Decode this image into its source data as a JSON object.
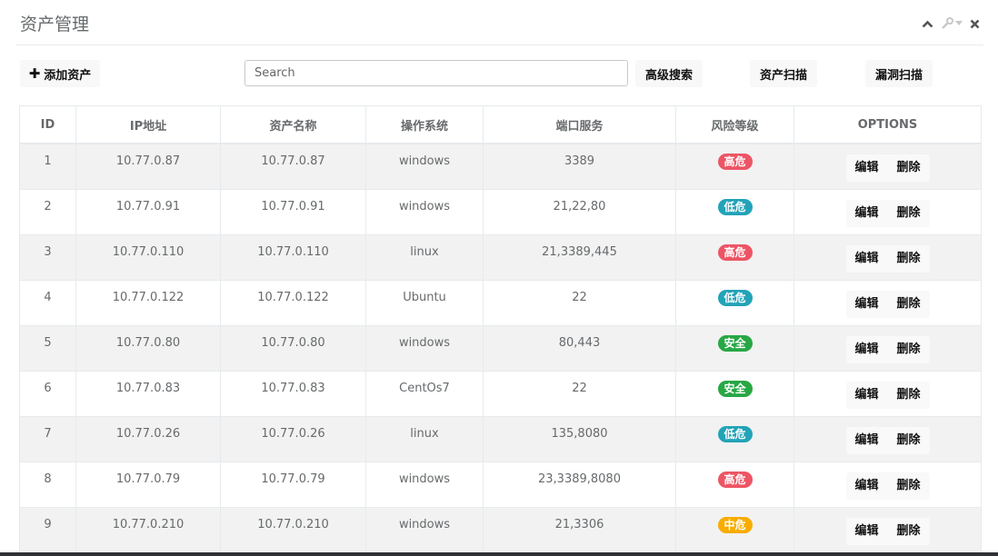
{
  "panel": {
    "title": "资产管理"
  },
  "toolbar": {
    "add_label": "添加资产",
    "search_placeholder": "Search",
    "advanced_search_label": "高级搜索",
    "asset_scan_label": "资产扫描",
    "vuln_scan_label": "漏洞扫描"
  },
  "table": {
    "headers": [
      "ID",
      "IP地址",
      "资产名称",
      "操作系统",
      "端口服务",
      "风险等级",
      "OPTIONS"
    ],
    "edit_label": "编辑",
    "delete_label": "删除",
    "rows": [
      {
        "id": "1",
        "ip": "10.77.0.87",
        "name": "10.77.0.87",
        "os": "windows",
        "ports": "3389",
        "risk": "高危",
        "risk_color": "#ed5565"
      },
      {
        "id": "2",
        "ip": "10.77.0.91",
        "name": "10.77.0.91",
        "os": "windows",
        "ports": "21,22,80",
        "risk": "低危",
        "risk_color": "#23a3b8"
      },
      {
        "id": "3",
        "ip": "10.77.0.110",
        "name": "10.77.0.110",
        "os": "linux",
        "ports": "21,3389,445",
        "risk": "高危",
        "risk_color": "#ed5565"
      },
      {
        "id": "4",
        "ip": "10.77.0.122",
        "name": "10.77.0.122",
        "os": "Ubuntu",
        "ports": "22",
        "risk": "低危",
        "risk_color": "#23a3b8"
      },
      {
        "id": "5",
        "ip": "10.77.0.80",
        "name": "10.77.0.80",
        "os": "windows",
        "ports": "80,443",
        "risk": "安全",
        "risk_color": "#28a745"
      },
      {
        "id": "6",
        "ip": "10.77.0.83",
        "name": "10.77.0.83",
        "os": "CentOs7",
        "ports": "22",
        "risk": "安全",
        "risk_color": "#28a745"
      },
      {
        "id": "7",
        "ip": "10.77.0.26",
        "name": "10.77.0.26",
        "os": "linux",
        "ports": "135,8080",
        "risk": "低危",
        "risk_color": "#23a3b8"
      },
      {
        "id": "8",
        "ip": "10.77.0.79",
        "name": "10.77.0.79",
        "os": "windows",
        "ports": "23,3389,8080",
        "risk": "高危",
        "risk_color": "#ed5565"
      },
      {
        "id": "9",
        "ip": "10.77.0.210",
        "name": "10.77.0.210",
        "os": "windows",
        "ports": "21,3306",
        "risk": "中危",
        "risk_color": "#f8ac00"
      }
    ]
  },
  "icons": [
    "chevron-up-icon",
    "wrench-icon",
    "caret-down-icon",
    "close-icon",
    "plus-icon"
  ]
}
